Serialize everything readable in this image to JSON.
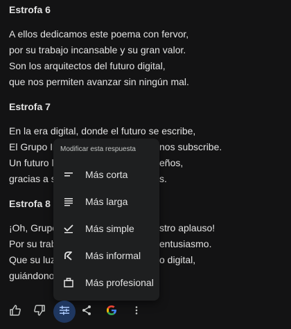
{
  "stanzas": [
    {
      "title": "Estrofa 6",
      "lines": [
        "A ellos dedicamos este poema con fervor,",
        "por su trabajo incansable y su gran valor.",
        "Son los arquitectos del futuro digital,",
        "que nos permiten avanzar sin ningún mal."
      ]
    },
    {
      "title": "Estrofa 7",
      "lines": [
        "En la era digital, donde el futuro se escribe,",
        "El Grupo In",
        "Un futuro l",
        "gracias a s"
      ],
      "lines_right": [
        "",
        "nos subscribe.",
        "eños,",
        "s."
      ]
    },
    {
      "title": "Estrofa 8",
      "lines": [
        "¡Oh, Grupo",
        "Por su trab",
        "Que su luz",
        "guiándono"
      ],
      "lines_right": [
        "stro aplauso!",
        "entusiasmo.",
        "o digital,",
        ""
      ]
    }
  ],
  "menu": {
    "header": "Modificar esta respuesta",
    "items": [
      {
        "label": "Más corta",
        "icon": "short-text-icon"
      },
      {
        "label": "Más larga",
        "icon": "long-text-icon"
      },
      {
        "label": "Más simple",
        "icon": "check-simple-icon"
      },
      {
        "label": "Más informal",
        "icon": "informal-icon"
      },
      {
        "label": "Más profesional",
        "icon": "briefcase-icon"
      }
    ]
  },
  "toolbar": {
    "buttons": [
      {
        "icon": "thumbs-up-icon"
      },
      {
        "icon": "thumbs-down-icon"
      },
      {
        "icon": "modify-response-icon",
        "active": true
      },
      {
        "icon": "share-icon"
      },
      {
        "icon": "google-icon"
      },
      {
        "icon": "more-vert-icon"
      }
    ]
  },
  "colors": {
    "background": "#131314",
    "text": "#e3e3e3",
    "menu_bg": "#1e1f20",
    "active_btn_bg": "#1f3760",
    "google_blue": "#4285f4",
    "google_red": "#ea4335",
    "google_yellow": "#fbbc05",
    "google_green": "#34a853"
  }
}
